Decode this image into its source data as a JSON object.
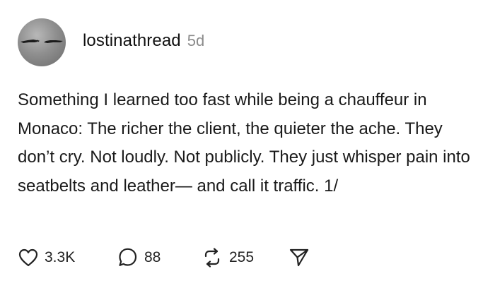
{
  "post": {
    "username": "lostinathread",
    "timestamp": "5d",
    "text": "Something I learned too fast while being a chauffeur in Monaco: The richer the client, the quieter the ache. They don’t cry. Not loudly. Not publicly. They just whisper pain into seatbelts and leather— and call it traffic. 1/"
  },
  "actions": {
    "likes": "3.3K",
    "replies": "88",
    "reposts": "255"
  },
  "icons": {
    "like": "heart-icon",
    "reply": "speech-bubble-icon",
    "repost": "repost-arrows-icon",
    "share": "paper-plane-icon"
  }
}
